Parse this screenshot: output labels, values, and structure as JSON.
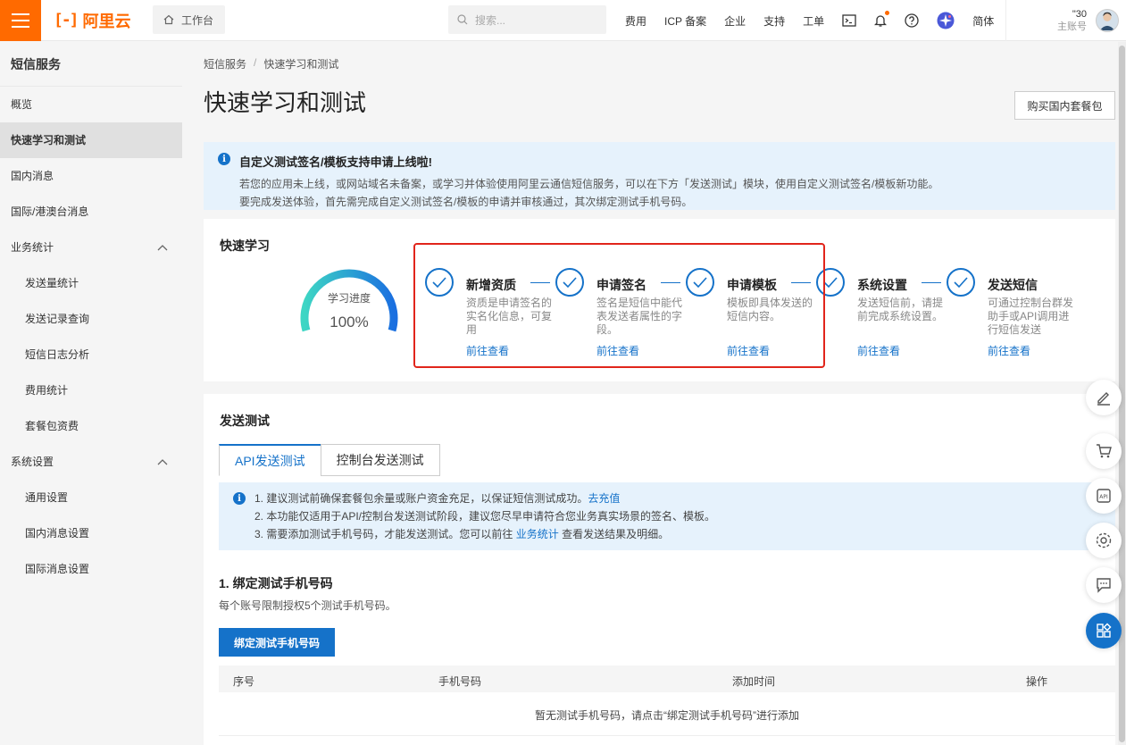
{
  "topbar": {
    "logo_text": "阿里云",
    "workbench_label": "工作台",
    "search_placeholder": "搜索...",
    "nav": [
      "费用",
      "ICP 备案",
      "企业",
      "支持",
      "工单"
    ],
    "language": "简体",
    "account_name": "\"30",
    "account_role": "主账号",
    "notification_dot_color": "#ff6a00"
  },
  "sidebar": {
    "title": "短信服务",
    "items": [
      {
        "label": "概览"
      },
      {
        "label": "快速学习和测试",
        "active": true
      },
      {
        "label": "国内消息"
      },
      {
        "label": "国际/港澳台消息"
      },
      {
        "label": "业务统计",
        "expanded": true
      },
      {
        "label": "发送量统计",
        "sub": true
      },
      {
        "label": "发送记录查询",
        "sub": true
      },
      {
        "label": "短信日志分析",
        "sub": true
      },
      {
        "label": "费用统计",
        "sub": true
      },
      {
        "label": "套餐包资费",
        "sub": true
      },
      {
        "label": "系统设置",
        "expanded": true
      },
      {
        "label": "通用设置",
        "sub": true
      },
      {
        "label": "国内消息设置",
        "sub": true
      },
      {
        "label": "国际消息设置",
        "sub": true
      }
    ]
  },
  "main": {
    "breadcrumb": [
      "短信服务",
      "快速学习和测试"
    ],
    "title": "快速学习和测试",
    "buy_button": "购买国内套餐包",
    "notice": {
      "title": "自定义测试签名/模板支持申请上线啦!",
      "line1": "若您的应用未上线，或网站域名未备案，或学习并体验使用阿里云通信短信服务，可以在下方「发送测试」模块，使用自定义测试签名/模板新功能。",
      "line2": "要完成发送体验，首先需完成自定义测试签名/模板的申请并审核通过，其次绑定测试手机号码。"
    },
    "quick_learn": {
      "title": "快速学习",
      "progress_label": "学习进度",
      "progress_text": "100%",
      "progress": 1.0,
      "steps": [
        {
          "name": "新增资质",
          "desc": "资质是申请签名的实名化信息，可复用",
          "link": "前往查看",
          "done": true
        },
        {
          "name": "申请签名",
          "desc": "签名是短信中能代表发送者属性的字段。",
          "link": "前往查看",
          "done": true
        },
        {
          "name": "申请模板",
          "desc": "模板即具体发送的短信内容。",
          "link": "前往查看",
          "done": true
        },
        {
          "name": "系统设置",
          "desc": "发送短信前，请提前完成系统设置。",
          "link": "前往查看",
          "done": true
        },
        {
          "name": "发送短信",
          "desc": "可通过控制台群发助手或API调用进行短信发送",
          "link": "前往查看",
          "done": true
        }
      ]
    },
    "send_test": {
      "title": "发送测试",
      "tabs": [
        {
          "label": "API发送测试",
          "active": true
        },
        {
          "label": "控制台发送测试"
        }
      ],
      "tips": {
        "line1_text": "1. 建议测试前确保套餐包余量或账户资金充足，以保证短信测试成功。",
        "line1_link": "去充值",
        "line2_text": "2. 本功能仅适用于API/控制台发送测试阶段，建议您尽早申请符合您业务真实场景的签名、模板。",
        "line3_pre": "3. 需要添加测试手机号码，才能发送测试。您可以前往",
        "line3_link": "业务统计",
        "line3_post": "查看发送结果及明细。"
      },
      "section_title": "1. 绑定测试手机号码",
      "section_desc": "每个账号限制授权5个测试手机号码。",
      "bind_button": "绑定测试手机号码",
      "table": {
        "columns": [
          "序号",
          "手机号码",
          "添加时间",
          "操作"
        ],
        "empty_text": "暂无测试手机号码，请点击“绑定测试手机号码”进行添加"
      }
    }
  },
  "colors": {
    "brand": "#ff6a00",
    "accent": "#1572c9",
    "highlight": "#e1251b"
  }
}
